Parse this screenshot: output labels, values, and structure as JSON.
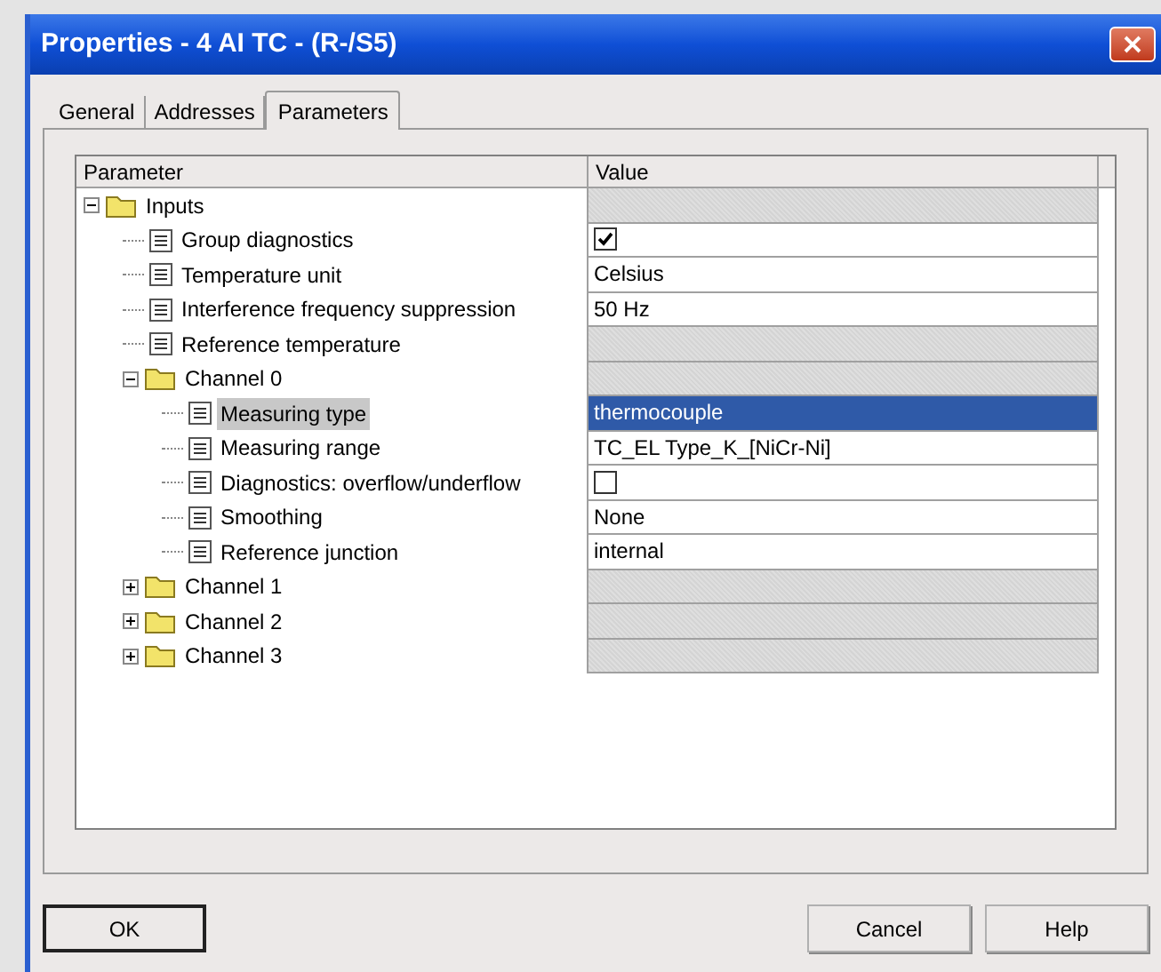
{
  "window": {
    "title": "Properties - 4 AI TC - (R-/S5)"
  },
  "tabs": [
    {
      "label": "General",
      "selected": false
    },
    {
      "label": "Addresses",
      "selected": false
    },
    {
      "label": "Parameters",
      "selected": true
    }
  ],
  "table": {
    "columns": [
      "Parameter",
      "Value"
    ],
    "rows": [
      {
        "kind": "folder",
        "label": "Inputs",
        "expanded": true,
        "selected": false,
        "children": [
          {
            "kind": "checkbox",
            "label": "Group diagnostics",
            "checked": true,
            "selected": false,
            "disabled": false
          },
          {
            "kind": "text",
            "label": "Temperature unit",
            "value": "Celsius",
            "selected": false,
            "disabled": false
          },
          {
            "kind": "text",
            "label": "Interference frequency suppression",
            "value": "50 Hz",
            "selected": false,
            "disabled": false
          },
          {
            "kind": "text",
            "label": "Reference temperature",
            "selected": false,
            "disabled": true
          },
          {
            "kind": "folder",
            "label": "Channel 0",
            "expanded": true,
            "selected": false,
            "children": [
              {
                "kind": "text",
                "label": "Measuring type",
                "value": "thermocouple",
                "selected": true,
                "disabled": false
              },
              {
                "kind": "text",
                "label": "Measuring range",
                "value": "TC_EL Type_K_[NiCr-Ni]",
                "selected": false,
                "disabled": false
              },
              {
                "kind": "checkbox",
                "label": "Diagnostics: overflow/underflow",
                "checked": false,
                "selected": false,
                "disabled": false
              },
              {
                "kind": "text",
                "label": "Smoothing",
                "value": "None",
                "selected": false,
                "disabled": false
              },
              {
                "kind": "text",
                "label": "Reference junction",
                "value": "internal",
                "selected": false,
                "disabled": false
              }
            ]
          },
          {
            "kind": "folder",
            "label": "Channel 1",
            "expanded": false,
            "selected": false
          },
          {
            "kind": "folder",
            "label": "Channel 2",
            "expanded": false,
            "selected": false
          },
          {
            "kind": "folder",
            "label": "Channel 3",
            "expanded": false,
            "selected": false
          }
        ]
      }
    ]
  },
  "buttons": [
    {
      "label": "OK",
      "default": true
    },
    {
      "label": "Cancel",
      "default": false
    },
    {
      "label": "Help",
      "default": false
    }
  ]
}
